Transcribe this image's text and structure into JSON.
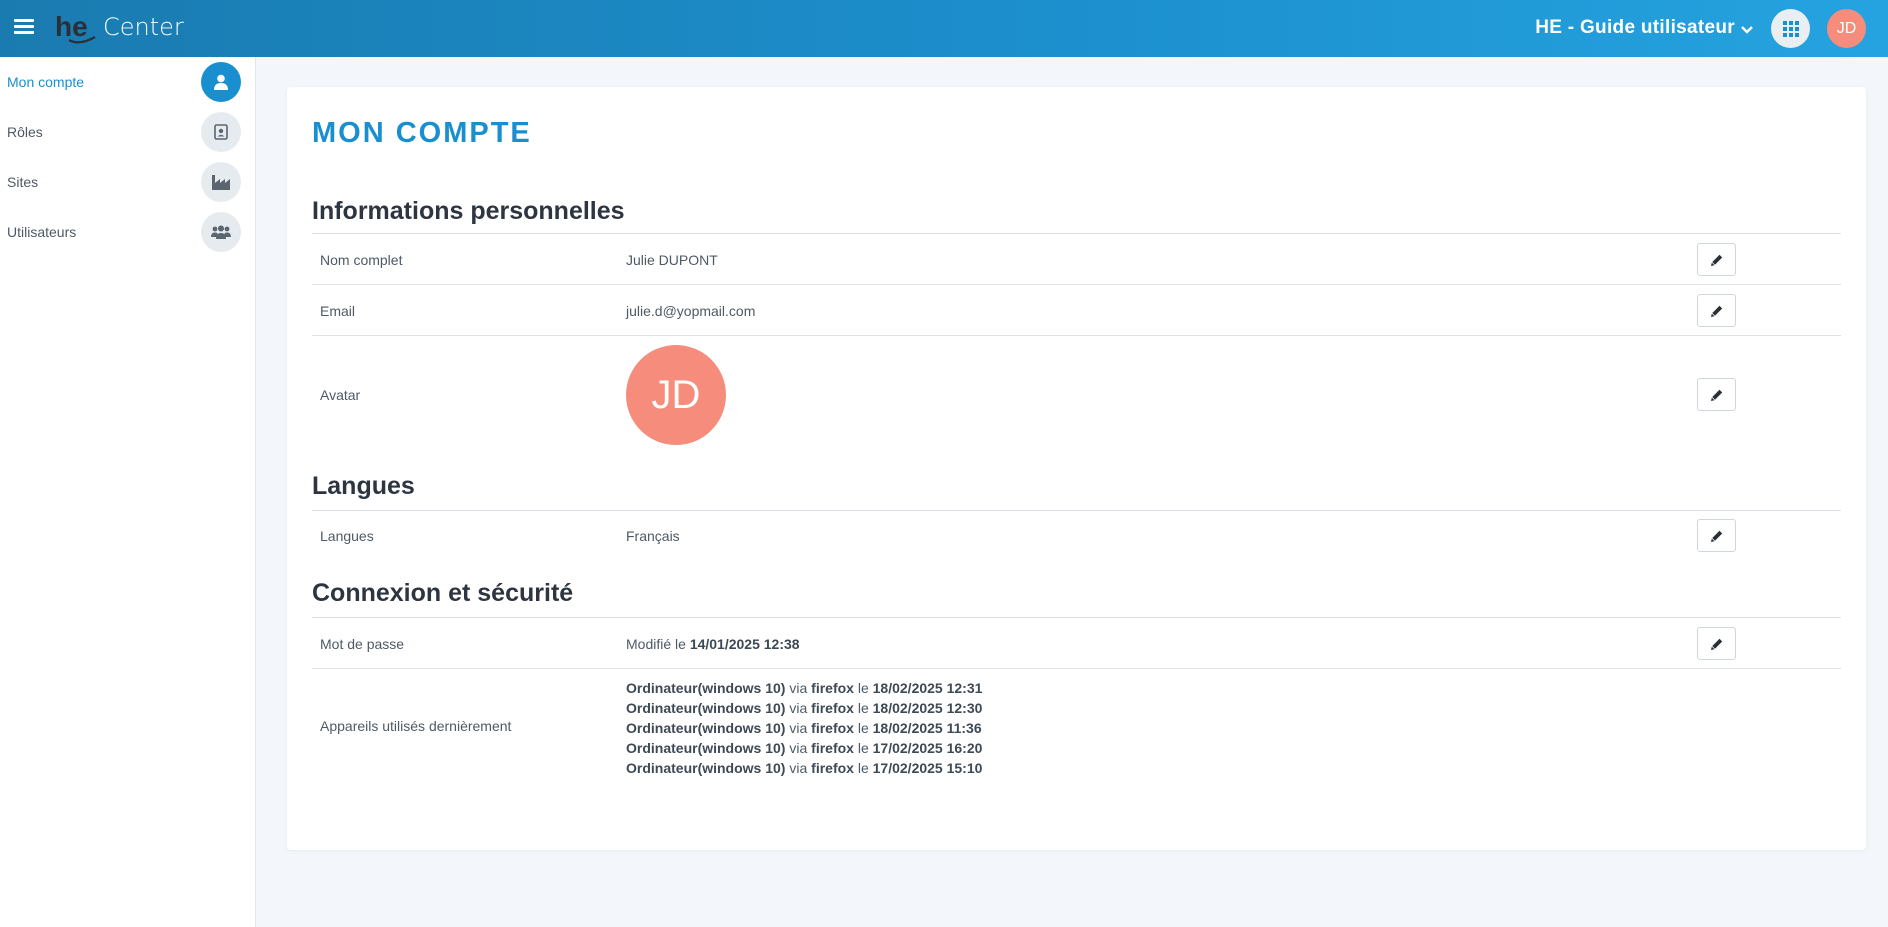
{
  "header": {
    "app_name": "Center",
    "logo_text": "he",
    "account_name": "HE - Guide utilisateur",
    "avatar_initials": "JD",
    "brand_color": "#1a8fcf",
    "avatar_color": "#f68c7c"
  },
  "sidebar": {
    "items": [
      {
        "label": "Mon compte",
        "icon": "user-icon"
      },
      {
        "label": "Rôles",
        "icon": "id-badge-icon"
      },
      {
        "label": "Sites",
        "icon": "factory-icon"
      },
      {
        "label": "Utilisateurs",
        "icon": "users-icon"
      }
    ]
  },
  "main": {
    "page_title": "MON COMPTE",
    "personal": {
      "title": "Informations personnelles",
      "fullname_label": "Nom complet",
      "fullname_value": "Julie DUPONT",
      "email_label": "Email",
      "email_value": "julie.d@yopmail.com",
      "avatar_label": "Avatar",
      "avatar_initials": "JD"
    },
    "languages": {
      "title": "Langues",
      "label": "Langues",
      "value": "Français"
    },
    "security": {
      "title": "Connexion et sécurité",
      "password_label": "Mot de passe",
      "password_prefix": "Modifié le",
      "password_date": "14/01/2025 12:38",
      "devices_label": "Appareils utilisés dernièrement",
      "device_via": "via",
      "device_on": "le",
      "devices": [
        {
          "device": "Ordinateur(windows 10)",
          "browser": "firefox",
          "date": "18/02/2025 12:31"
        },
        {
          "device": "Ordinateur(windows 10)",
          "browser": "firefox",
          "date": "18/02/2025 12:30"
        },
        {
          "device": "Ordinateur(windows 10)",
          "browser": "firefox",
          "date": "18/02/2025 11:36"
        },
        {
          "device": "Ordinateur(windows 10)",
          "browser": "firefox",
          "date": "17/02/2025 16:20"
        },
        {
          "device": "Ordinateur(windows 10)",
          "browser": "firefox",
          "date": "17/02/2025 15:10"
        }
      ]
    }
  }
}
